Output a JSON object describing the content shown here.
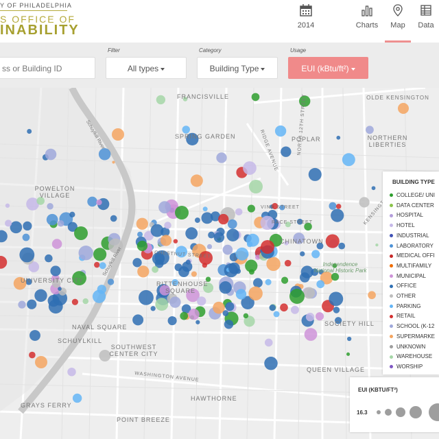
{
  "header": {
    "logo_line1": "Y OF PHILADELPHIA",
    "logo_line2": "S OFFICE OF",
    "logo_line3": "INABILITY",
    "nav": [
      {
        "label": "2014",
        "icon": "calendar-icon"
      },
      {
        "label": "Charts",
        "icon": "bar-chart-icon"
      },
      {
        "label": "Map",
        "icon": "map-pin-icon",
        "active": true
      },
      {
        "label": "Data",
        "icon": "table-icon"
      }
    ]
  },
  "filters": {
    "search_placeholder": "ss or Building ID",
    "filter_label": "Filter",
    "filter_value": "All types",
    "category_label": "Category",
    "category_value": "Building Type",
    "usage_label": "Usage",
    "usage_value": "EUI (kBtu/ft²)"
  },
  "map_labels": {
    "francisville": "FRANCISVILLE",
    "olde_kensington": "OLDE KENSINGTON",
    "spring_garden": "SPRING GARDEN",
    "poplar": "POPLAR",
    "northern_liberties": "NORTHERN LIBERTIES",
    "powelton_village": "POWELTON VILLAGE",
    "vine_street": "VINE STREET",
    "race_street": "RACE STREET",
    "chinatown": "CHINATOWN",
    "independence_park": "Independence National Historic Park",
    "university_city": "UNIVERSITY CITY",
    "rittenhouse_square": "RITTENHOUSE SQUARE",
    "society_hill": "SOCIETY HILL",
    "naval_square": "NAVAL SQUARE",
    "schuylkill": "SCHUYLKILL",
    "southwest_center_city": "SOUTHWEST CENTER CITY",
    "queen_village": "QUEEN VILLAGE",
    "washington_avenue": "WASHINGTON AVENUE",
    "hawthorne": "HAWTHORNE",
    "grays_ferry": "GRAYS FERRY",
    "point_breeze": "POINT BREEZE",
    "schuylkill_river": "Schuylkill River",
    "ridge_avenue": "RIDGE AVENUE",
    "chestnut_street": "CHESTNUT STREET",
    "north_street": "NORTH 12TH STREET",
    "kensington_avenue": "KENSINGTON AVENUE"
  },
  "legend": {
    "title": "BUILDING TYPE",
    "items": [
      {
        "label": "COLLEGE/ UNI",
        "color": "#2e9e2e"
      },
      {
        "label": "DATA CENTER",
        "color": "#8bc34a"
      },
      {
        "label": "HOSPITAL",
        "color": "#b39ddb"
      },
      {
        "label": "HOTEL",
        "color": "#c5b8e8"
      },
      {
        "label": "INDUSTRIAL",
        "color": "#3f51b5"
      },
      {
        "label": "LABORATORY",
        "color": "#4e92d6"
      },
      {
        "label": "MEDICAL OFFI",
        "color": "#c62828"
      },
      {
        "label": "MULTIFAMILY",
        "color": "#ef6c00"
      },
      {
        "label": "MUNICIPAL",
        "color": "#ce93d8"
      },
      {
        "label": "OFFICE",
        "color": "#2f6fb3"
      },
      {
        "label": "OTHER",
        "color": "#bdbdbd"
      },
      {
        "label": "PARKING",
        "color": "#64b5f6"
      },
      {
        "label": "RETAIL",
        "color": "#d32f2f"
      },
      {
        "label": "SCHOOL (K-12",
        "color": "#9fa8da"
      },
      {
        "label": "SUPERMARKE",
        "color": "#f4a460"
      },
      {
        "label": "UNKNOWN",
        "color": "#9e9e9e"
      },
      {
        "label": "WAREHOUSE",
        "color": "#a5d6a7"
      },
      {
        "label": "WORSHIP",
        "color": "#7e57c2"
      }
    ]
  },
  "eui_legend": {
    "title": "EUI (KBTU/FT²)",
    "min_value": "16.3"
  },
  "colors": {
    "accent": "#f08a8a",
    "logo": "#a7a030",
    "office": "#2f6fb3",
    "college": "#2e9e2e"
  }
}
